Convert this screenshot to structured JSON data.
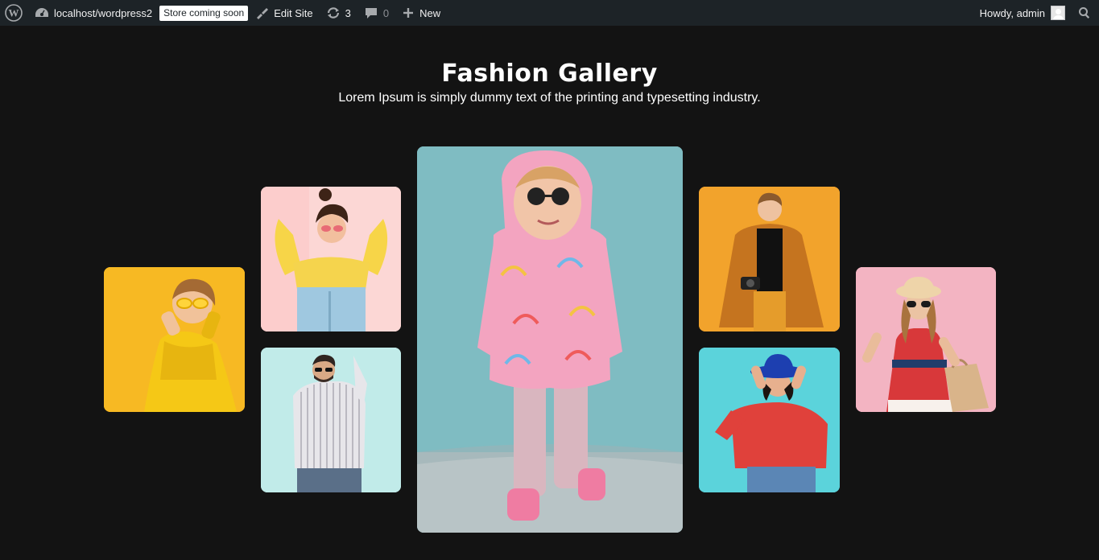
{
  "adminbar": {
    "site_name": "localhost/wordpress2",
    "store_badge": "Store coming soon",
    "edit_site": "Edit Site",
    "updates_count": "3",
    "comments_count": "0",
    "new_label": "New",
    "howdy": "Howdy, admin"
  },
  "hero": {
    "title": "Fashion Gallery",
    "subtitle": "Lorem Ipsum is simply dummy text of the printing and typesetting industry."
  },
  "colors": {
    "background": "#131313",
    "adminbar": "#1d2327"
  },
  "gallery": {
    "images": [
      {
        "name": "girl-yellow-dress",
        "bg": "#f4b41c"
      },
      {
        "name": "woman-yellow-sweater",
        "bg": "#fbd3d3"
      },
      {
        "name": "man-striped-shirt",
        "bg": "#bfeae8"
      },
      {
        "name": "child-rainbow-raincoat",
        "bg": "#7fbac0"
      },
      {
        "name": "man-orange-coat",
        "bg": "#f0a22a"
      },
      {
        "name": "woman-blue-hat",
        "bg": "#56d4dc"
      },
      {
        "name": "girl-red-dress-shopping-bag",
        "bg": "#f3b6c3"
      }
    ]
  }
}
